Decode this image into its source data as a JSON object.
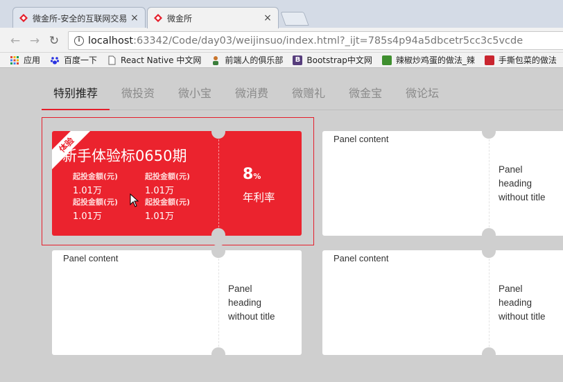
{
  "browser": {
    "tabs": [
      {
        "title": "微金所-安全的互联网交易",
        "active": false
      },
      {
        "title": "微金所",
        "active": true
      }
    ],
    "close_glyph": "×",
    "address": {
      "host": "localhost",
      "path": ":63342/Code/day03/weijinsuo/index.html?_ijt=785s4p94a5dbcetr5cc3c5vcde"
    },
    "bookmarks": [
      {
        "label": "应用",
        "icon": "apps-grid-icon"
      },
      {
        "label": "百度一下",
        "icon": "baidu-paw-icon"
      },
      {
        "label": "React Native 中文网",
        "icon": "page-icon"
      },
      {
        "label": "前端人的俱乐部",
        "icon": "person-icon"
      },
      {
        "label": "Bootstrap中文网",
        "icon": "bootstrap-icon"
      },
      {
        "label": "辣椒炒鸡蛋的做法_辣",
        "icon": "recipe-icon"
      },
      {
        "label": "手撕包菜的做法",
        "icon": "recipe-red-icon"
      }
    ]
  },
  "nav": {
    "tabs": [
      "特别推荐",
      "微投资",
      "微小宝",
      "微消费",
      "微赠礼",
      "微金宝",
      "微论坛"
    ],
    "active_index": 0
  },
  "featured": {
    "ribbon": "体验",
    "title": "新手体验标0650期",
    "stats": [
      {
        "label": "起投金额(元)",
        "value": "1.01万"
      },
      {
        "label": "起投金额(元)",
        "value": "1.01万"
      },
      {
        "label": "起投金额(元)",
        "value": "1.01万"
      },
      {
        "label": "起投金额(元)",
        "value": "1.01万"
      }
    ],
    "rate_value": "8",
    "rate_unit": "%",
    "rate_label": "年利率"
  },
  "panels": [
    {
      "content": "Panel content",
      "heading": "Panel heading without title"
    },
    {
      "content": "Panel content",
      "heading": "Panel heading without title"
    },
    {
      "content": "Panel content",
      "heading": "Panel heading without title"
    }
  ],
  "colors": {
    "accent": "#eb232e",
    "page_bg": "#cfcfcf"
  }
}
